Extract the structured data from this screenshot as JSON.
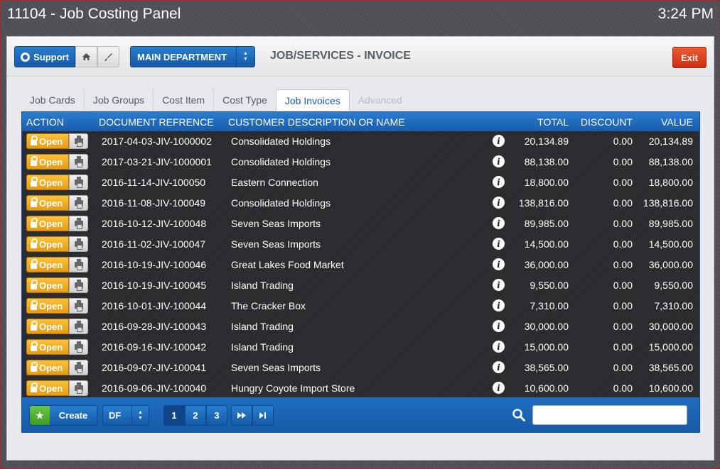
{
  "window": {
    "title": "11104 - Job Costing Panel",
    "time": "3:24 PM"
  },
  "toolbar": {
    "support_label": "Support",
    "department_label": "MAIN DEPARTMENT",
    "page_title": "JOB/SERVICES - INVOICE",
    "exit_label": "Exit"
  },
  "tabs": [
    {
      "label": "Job Cards"
    },
    {
      "label": "Job Groups"
    },
    {
      "label": "Cost Item"
    },
    {
      "label": "Cost Type"
    },
    {
      "label": "Job Invoices"
    },
    {
      "label": "Advanced"
    }
  ],
  "active_tab": "Job Invoices",
  "grid": {
    "headers": {
      "action": "ACTION",
      "document": "DOCUMENT REFRENCE",
      "customer": "CUSTOMER DESCRIPTION OR NAME",
      "total": "TOTAL",
      "discount": "DISCOUNT",
      "value": "VALUE"
    },
    "open_label": "Open",
    "rows": [
      {
        "doc": "2017-04-03-JIV-1000002",
        "customer": "Consolidated Holdings",
        "total": "20,134.89",
        "discount": "0.00",
        "value": "20,134.89"
      },
      {
        "doc": "2017-03-21-JIV-1000001",
        "customer": "Consolidated Holdings",
        "total": "88,138.00",
        "discount": "0.00",
        "value": "88,138.00"
      },
      {
        "doc": "2016-11-14-JIV-100050",
        "customer": "Eastern Connection",
        "total": "18,800.00",
        "discount": "0.00",
        "value": "18,800.00"
      },
      {
        "doc": "2016-11-08-JIV-100049",
        "customer": "Consolidated Holdings",
        "total": "138,816.00",
        "discount": "0.00",
        "value": "138,816.00"
      },
      {
        "doc": "2016-10-12-JIV-100048",
        "customer": "Seven Seas Imports",
        "total": "89,985.00",
        "discount": "0.00",
        "value": "89,985.00"
      },
      {
        "doc": "2016-11-02-JIV-100047",
        "customer": "Seven Seas Imports",
        "total": "14,500.00",
        "discount": "0.00",
        "value": "14,500.00"
      },
      {
        "doc": "2016-10-19-JIV-100046",
        "customer": "Great Lakes Food Market",
        "total": "36,000.00",
        "discount": "0.00",
        "value": "36,000.00"
      },
      {
        "doc": "2016-10-19-JIV-100045",
        "customer": "Island Trading",
        "total": "9,550.00",
        "discount": "0.00",
        "value": "9,550.00"
      },
      {
        "doc": "2016-10-01-JIV-100044",
        "customer": "The Cracker Box",
        "total": "7,310.00",
        "discount": "0.00",
        "value": "7,310.00"
      },
      {
        "doc": "2016-09-28-JIV-100043",
        "customer": "Island Trading",
        "total": "30,000.00",
        "discount": "0.00",
        "value": "30,000.00"
      },
      {
        "doc": "2016-09-16-JIV-100042",
        "customer": "Island Trading",
        "total": "15,000.00",
        "discount": "0.00",
        "value": "15,000.00"
      },
      {
        "doc": "2016-09-07-JIV-100041",
        "customer": "Seven Seas Imports",
        "total": "38,565.00",
        "discount": "0.00",
        "value": "38,565.00"
      },
      {
        "doc": "2016-09-06-JIV-100040",
        "customer": "Hungry Coyote Import Store",
        "total": "10,600.00",
        "discount": "0.00",
        "value": "10,600.00"
      }
    ]
  },
  "footer": {
    "create_label": "Create",
    "format_label": "DF",
    "pages": [
      "1",
      "2",
      "3"
    ],
    "current_page": "1",
    "search_value": "",
    "search_placeholder": ""
  },
  "icons": {
    "support": "lifebuoy-icon",
    "home": "home-icon",
    "brush": "brush-icon",
    "open": "lock-icon",
    "print": "printer-icon",
    "info": "info-icon",
    "create": "star-icon",
    "next": "fast-forward-icon",
    "last": "skip-to-end-icon",
    "search": "search-icon"
  },
  "colors": {
    "accent": "#1a5cab",
    "open_button": "#f0a51e",
    "exit_button": "#dd4420",
    "create_star": "#52b030"
  }
}
